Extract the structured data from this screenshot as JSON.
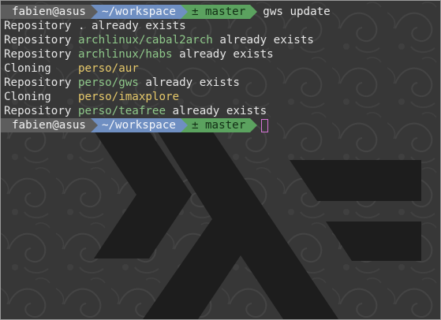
{
  "colors": {
    "background": "#373737",
    "prompt_user_bg": "#5d5d5d",
    "prompt_dir_bg": "#6f8fc2",
    "prompt_git_bg": "#5ba25f",
    "repo_name_green": "#8fc88a",
    "clone_name_yellow": "#e5c86a",
    "cursor": "#d673d6",
    "logo": "#1c1c1c"
  },
  "background_logo": "haskell-logo",
  "prompt1": {
    "user": "fabien@asus",
    "dir": "~/workspace",
    "git": "± master",
    "command": "gws update"
  },
  "output": [
    {
      "prefix": "Repository ",
      "name": ".",
      "suffix": " already exists"
    },
    {
      "prefix": "Repository ",
      "name": "archlinux/cabal2arch",
      "suffix": " already exists"
    },
    {
      "prefix": "Repository ",
      "name": "archlinux/habs",
      "suffix": " already exists"
    },
    {
      "prefix": "Cloning    ",
      "name": "perso/aur",
      "suffix": ""
    },
    {
      "prefix": "Repository ",
      "name": "perso/gws",
      "suffix": " already exists"
    },
    {
      "prefix": "Cloning    ",
      "name": "perso/imaxplore",
      "suffix": ""
    },
    {
      "prefix": "Repository ",
      "name": "perso/teafree",
      "suffix": " already exists"
    }
  ],
  "prompt2": {
    "user": "fabien@asus",
    "dir": "~/workspace",
    "git": "± master"
  }
}
